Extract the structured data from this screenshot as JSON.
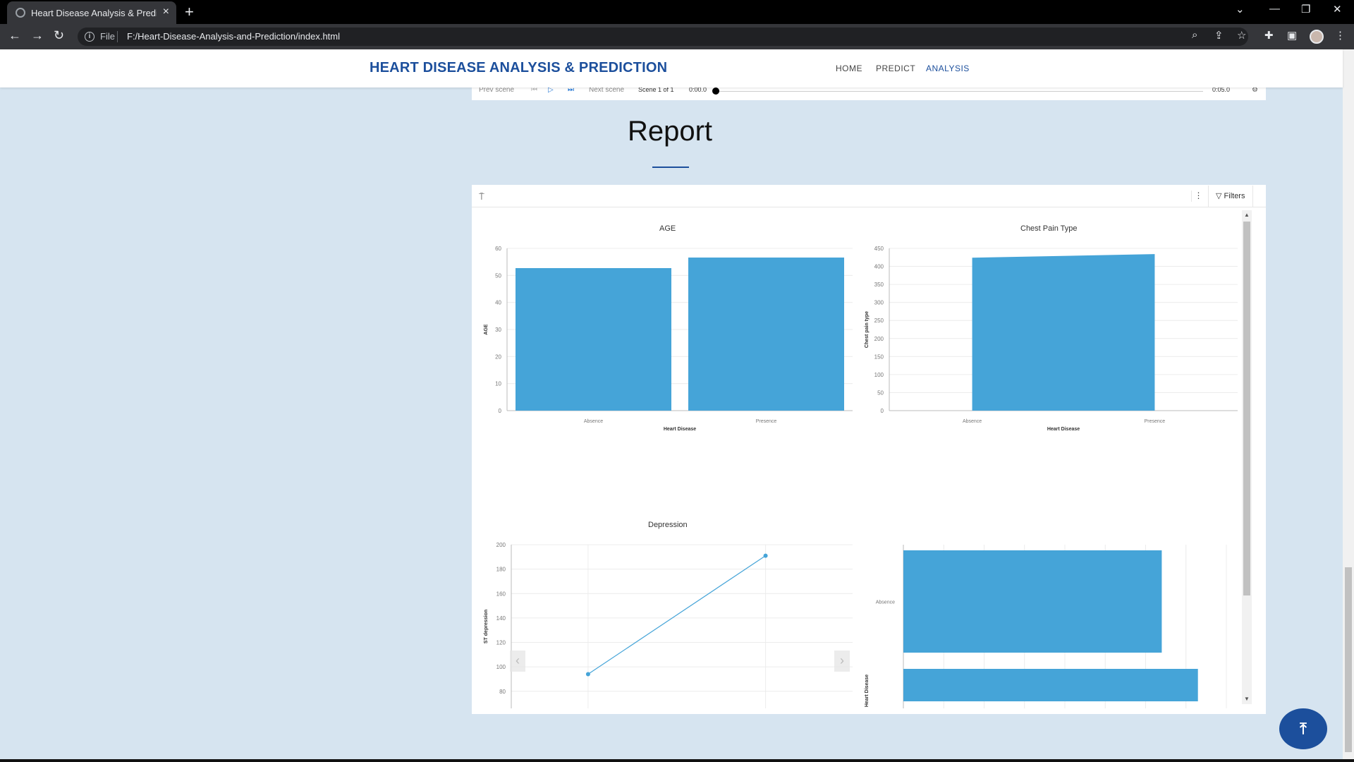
{
  "browser": {
    "tab_title": "Heart Disease Analysis & Prediction",
    "url_scheme": "File",
    "url": "F:/Heart-Disease-Analysis-and-Prediction/index.html"
  },
  "site": {
    "brand": "HEART DISEASE ANALYSIS & PREDICTION",
    "nav": [
      "HOME",
      "PREDICT",
      "ANALYSIS"
    ],
    "active_nav": "ANALYSIS",
    "accent_color": "#1c4f9c",
    "background_color": "#d6e4f0"
  },
  "scene": {
    "prev": "Prev scene",
    "next": "Next scene",
    "counter": "Scene 1 of 1",
    "start_time": "0:00.0",
    "end_time": "0:05.0"
  },
  "report": {
    "title": "Report",
    "filters_label": "Filters"
  },
  "chart_data": [
    {
      "type": "bar",
      "title": "AGE",
      "xlabel": "Heart Disease",
      "ylabel": "AGE",
      "categories": [
        "Absence",
        "Presence"
      ],
      "values": [
        52.7,
        56.6
      ],
      "ylim": [
        0,
        60
      ],
      "yticks": [
        0,
        10,
        20,
        30,
        40,
        50,
        60
      ],
      "grid": true,
      "color": "#45a4d8"
    },
    {
      "type": "area",
      "title": "Chest Pain Type",
      "xlabel": "Heart Disease",
      "ylabel": "Chest pain type",
      "categories": [
        "Absence",
        "Presence"
      ],
      "values": [
        424,
        434
      ],
      "ylim": [
        0,
        450
      ],
      "yticks": [
        0,
        50,
        100,
        150,
        200,
        250,
        300,
        350,
        400,
        450
      ],
      "grid": true,
      "color": "#45a4d8"
    },
    {
      "type": "line",
      "title": "Depression",
      "ylabel": "ST depression",
      "x_count": 2,
      "values": [
        94,
        191
      ],
      "ylim": [
        66,
        200
      ],
      "yticks": [
        80,
        100,
        120,
        140,
        160,
        180,
        200
      ],
      "grid": true,
      "color": "#45a4d8"
    },
    {
      "type": "bar",
      "orientation": "horizontal",
      "title": "",
      "ylabel": "Heart Disease",
      "categories": [
        "Absence",
        ""
      ],
      "values": [
        100,
        114
      ],
      "color": "#45a4d8"
    }
  ]
}
